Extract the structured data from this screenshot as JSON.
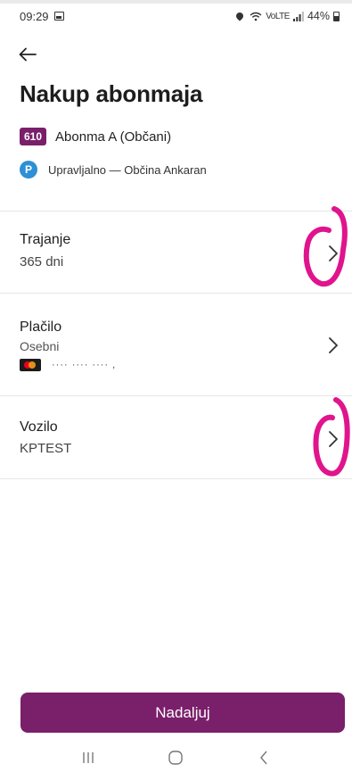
{
  "status_bar": {
    "time": "09:29",
    "battery": "44%",
    "network": "VoLTE"
  },
  "page": {
    "title": "Nakup abonmaja"
  },
  "subscription": {
    "zone_badge": "610",
    "name": "Abonma A (Občani)"
  },
  "provider": {
    "icon_letter": "P",
    "name": "Upravljalno — Občina Ankaran"
  },
  "settings": {
    "duration": {
      "label": "Trajanje",
      "value": "365 dni"
    },
    "payment": {
      "label": "Plačilo",
      "value": "Osebni",
      "card_masked": "···· ···· ···· ,"
    },
    "vehicle": {
      "label": "Vozilo",
      "value": "KPTEST"
    }
  },
  "actions": {
    "continue_label": "Nadaljuj"
  },
  "colors": {
    "accent": "#7a1f6a",
    "parking_icon": "#2d8fd5",
    "annotation": "#e0148c"
  },
  "icons": [
    "gallery-icon",
    "location-icon",
    "wifi-icon",
    "signal-icon",
    "battery-icon",
    "back-arrow-icon",
    "parking-icon",
    "mastercard-icon",
    "chevron-right-icon",
    "recent-apps-icon",
    "home-icon",
    "nav-back-icon"
  ]
}
